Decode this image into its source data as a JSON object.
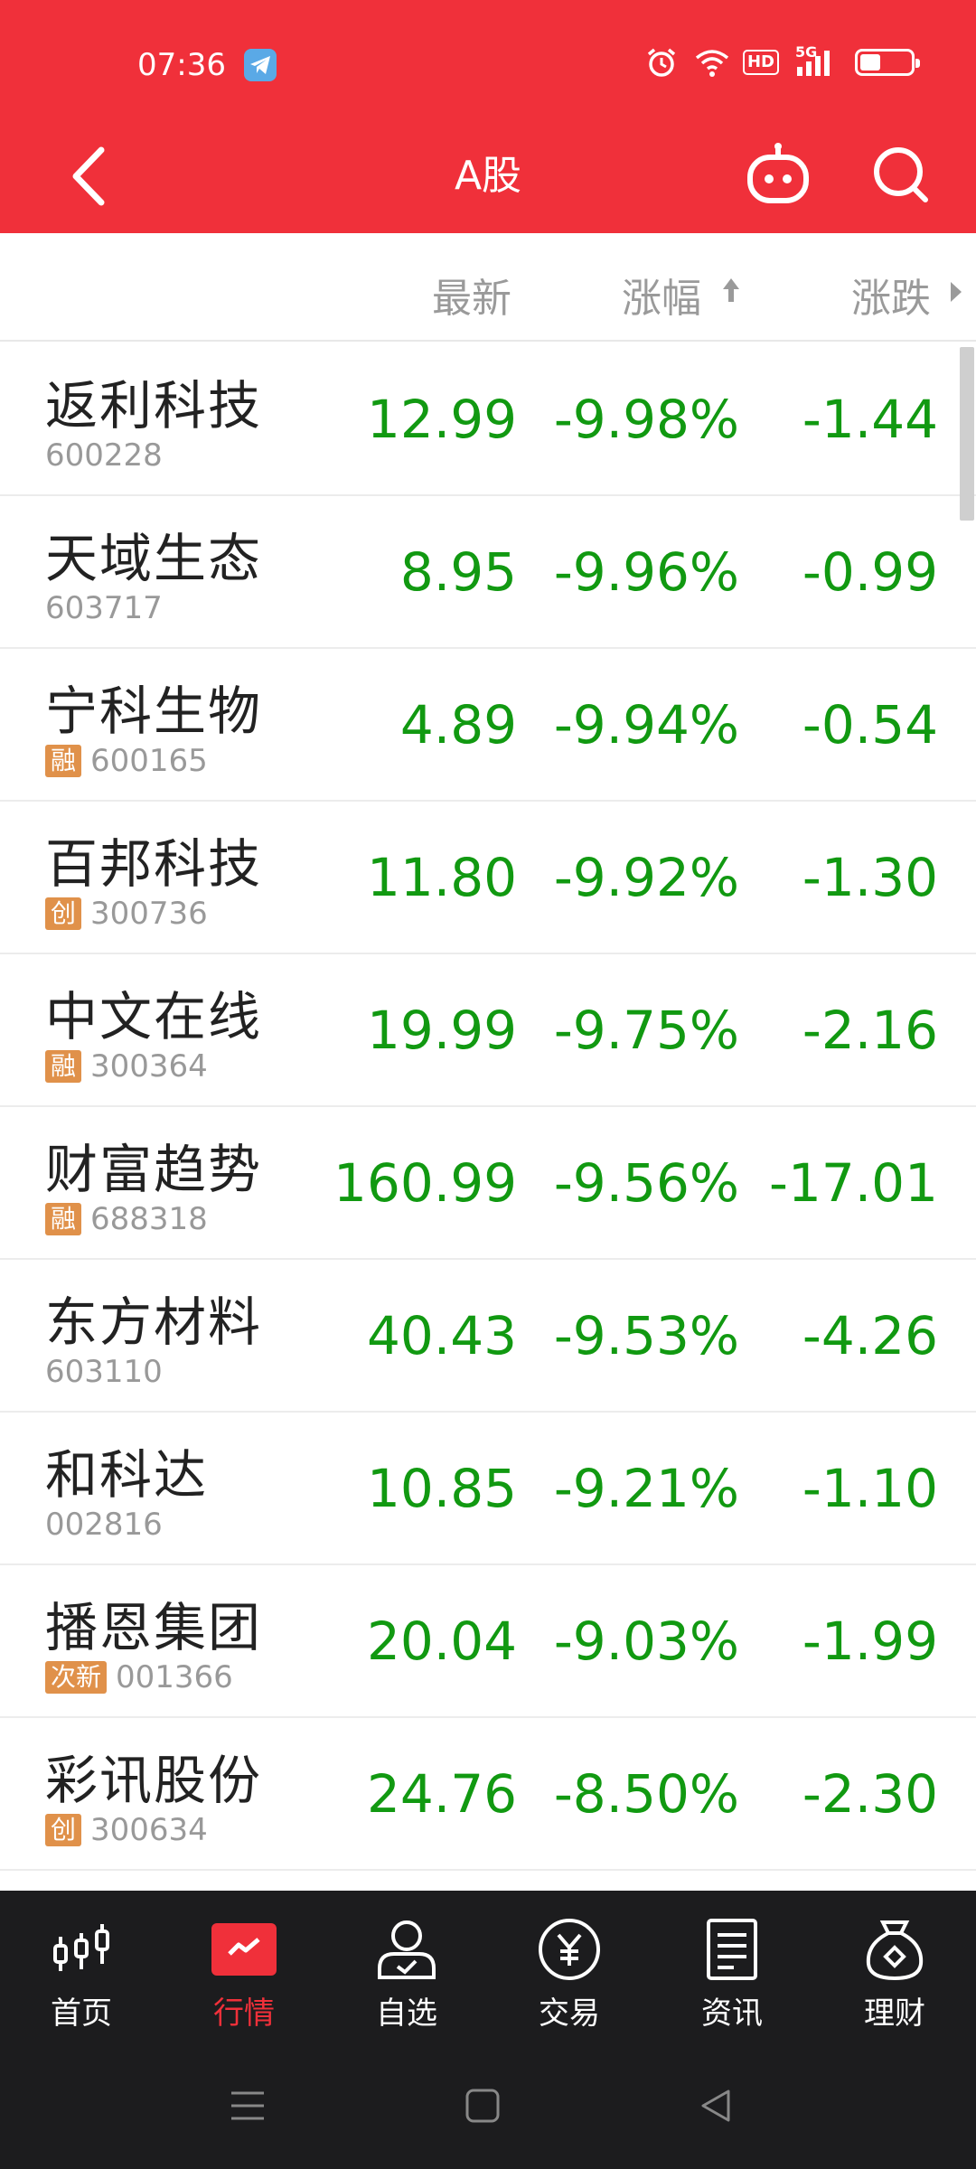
{
  "status_bar": {
    "time": "07:36",
    "network_label": "5G",
    "hd_label": "HD"
  },
  "nav": {
    "title": "A股"
  },
  "columns": {
    "latest": "最新",
    "pct_change": "涨幅",
    "change": "涨跌"
  },
  "colors": {
    "brand_red": "#f0303a",
    "down_green": "#119911",
    "badge_orange": "#e0914a"
  },
  "stocks": [
    {
      "name": "返利科技",
      "code": "600228",
      "badge": "",
      "price": "12.99",
      "pct": "-9.98%",
      "change": "-1.44"
    },
    {
      "name": "天域生态",
      "code": "603717",
      "badge": "",
      "price": "8.95",
      "pct": "-9.96%",
      "change": "-0.99"
    },
    {
      "name": "宁科生物",
      "code": "600165",
      "badge": "融",
      "price": "4.89",
      "pct": "-9.94%",
      "change": "-0.54"
    },
    {
      "name": "百邦科技",
      "code": "300736",
      "badge": "创",
      "price": "11.80",
      "pct": "-9.92%",
      "change": "-1.30"
    },
    {
      "name": "中文在线",
      "code": "300364",
      "badge": "融",
      "price": "19.99",
      "pct": "-9.75%",
      "change": "-2.16"
    },
    {
      "name": "财富趋势",
      "code": "688318",
      "badge": "融",
      "price": "160.99",
      "pct": "-9.56%",
      "change": "-17.01"
    },
    {
      "name": "东方材料",
      "code": "603110",
      "badge": "",
      "price": "40.43",
      "pct": "-9.53%",
      "change": "-4.26"
    },
    {
      "name": "和科达",
      "code": "002816",
      "badge": "",
      "price": "10.85",
      "pct": "-9.21%",
      "change": "-1.10"
    },
    {
      "name": "播恩集团",
      "code": "001366",
      "badge": "次新",
      "price": "20.04",
      "pct": "-9.03%",
      "change": "-1.99"
    },
    {
      "name": "彩讯股份",
      "code": "300634",
      "badge": "创",
      "price": "24.76",
      "pct": "-8.50%",
      "change": "-2.30"
    }
  ],
  "tabs": [
    {
      "label": "首页",
      "icon": "candlestick-icon"
    },
    {
      "label": "行情",
      "icon": "market-chart-icon"
    },
    {
      "label": "自选",
      "icon": "user-watchlist-icon"
    },
    {
      "label": "交易",
      "icon": "yuan-coin-icon"
    },
    {
      "label": "资讯",
      "icon": "news-document-icon"
    },
    {
      "label": "理财",
      "icon": "money-bag-icon"
    }
  ]
}
